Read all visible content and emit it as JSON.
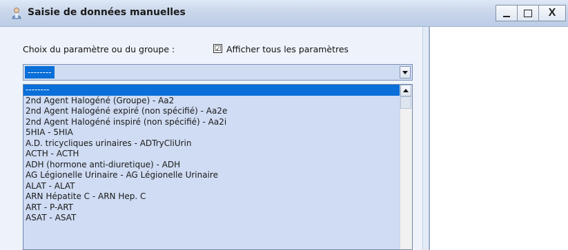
{
  "window": {
    "title": "Saisie de données manuelles",
    "controls": {
      "minimize": "_",
      "close": "X"
    },
    "icon": "app-user-icon"
  },
  "form": {
    "param_label": "Choix du paramètre ou du groupe :",
    "show_all": {
      "label": "Afficher tous les paramètres",
      "checked": true,
      "mark": "☑"
    },
    "combo_value": "--------"
  },
  "dropdown": {
    "items": [
      "--------",
      "2nd Agent Halogéné (Groupe) - Aa2",
      "2nd Agent Halogéné expiré (non spécifié) - Aa2e",
      "2nd Agent Halogéné inspiré (non spécifié) - Aa2i",
      "5HIA - 5HIA",
      "A.D. tricycliques urinaires - ADTryCliUrin",
      "ACTH - ACTH",
      "ADH (hormone anti-diuretique) - ADH",
      "AG Légionelle Urinaire - AG Légionelle Urinaire",
      "ALAT - ALAT",
      "ARN Hépatite C - ARN Hep. C",
      "ART - P-ART",
      "ASAT - ASAT"
    ],
    "selected_index": 0
  },
  "colors": {
    "selection": "#0a6fd8",
    "list_background": "#cfdcf3",
    "titlebar": "#c9d6ea"
  }
}
